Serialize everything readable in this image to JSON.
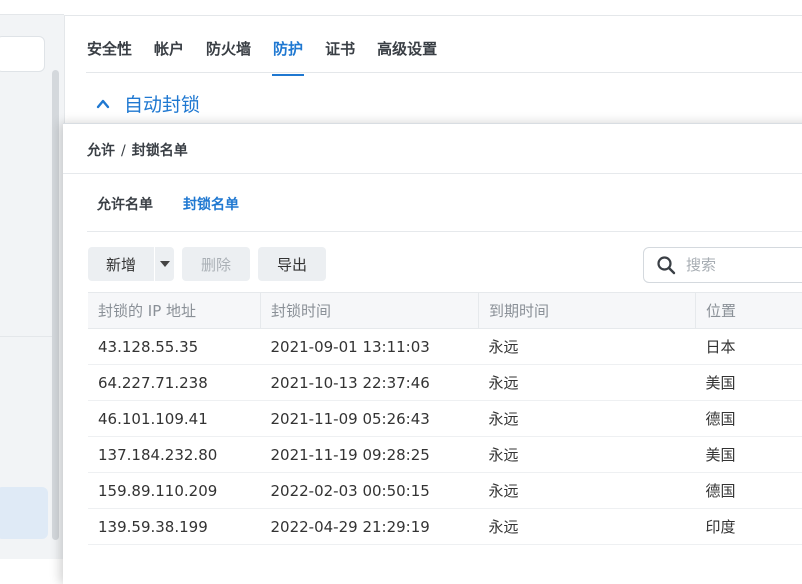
{
  "tabs": [
    {
      "label": "安全性"
    },
    {
      "label": "帐户"
    },
    {
      "label": "防火墙"
    },
    {
      "label": "防护",
      "active": true
    },
    {
      "label": "证书"
    },
    {
      "label": "高级设置"
    }
  ],
  "section": {
    "title": "自动封锁",
    "icon": "chevron-up-icon"
  },
  "dialog": {
    "breadcrumb": {
      "parent": "允许",
      "separator": "/",
      "current": "封锁名单"
    },
    "subtabs": [
      {
        "label": "允许名单"
      },
      {
        "label": "封锁名单",
        "active": true
      }
    ],
    "toolbar": {
      "add_label": "新增",
      "delete_label": "删除",
      "export_label": "导出"
    },
    "search": {
      "placeholder": "搜索",
      "icon": "search-icon"
    },
    "table": {
      "columns": [
        "封锁的 IP 地址",
        "封锁时间",
        "到期时间",
        "位置"
      ],
      "rows": [
        [
          "43.128.55.35",
          "2021-09-01 13:11:03",
          "永远",
          "日本"
        ],
        [
          "64.227.71.238",
          "2021-10-13 22:37:46",
          "永远",
          "美国"
        ],
        [
          "46.101.109.41",
          "2021-11-09 05:26:43",
          "永远",
          "德国"
        ],
        [
          "137.184.232.80",
          "2021-11-19 09:28:25",
          "永远",
          "美国"
        ],
        [
          "159.89.110.209",
          "2022-02-03 00:50:15",
          "永远",
          "德国"
        ],
        [
          "139.59.38.199",
          "2022-04-29 21:29:19",
          "永远",
          "印度"
        ]
      ]
    }
  },
  "colors": {
    "accent": "#1f78d1",
    "disabled_text": "#aab0b6"
  }
}
